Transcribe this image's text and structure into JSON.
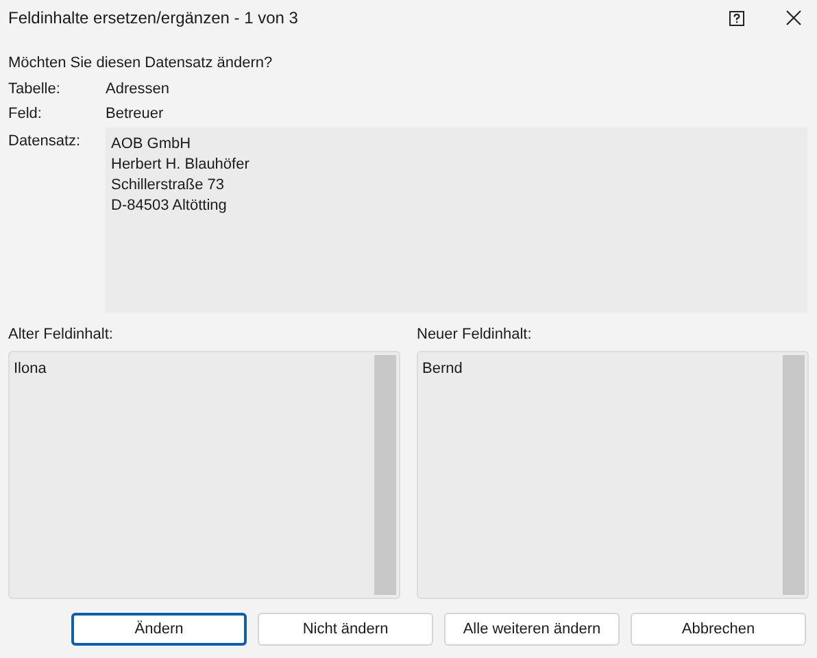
{
  "window": {
    "title": "Feldinhalte ersetzen/ergänzen - 1 von 3"
  },
  "question": "Möchten Sie diesen Datensatz ändern?",
  "info": [
    {
      "label": "Tabelle:",
      "value": "Adressen"
    },
    {
      "label": "Feld:",
      "value": "Betreuer"
    }
  ],
  "record": {
    "label": "Datensatz:",
    "lines": [
      "AOB GmbH",
      "Herbert H. Blauhöfer",
      "Schillerstraße 73",
      "D-84503 Altötting"
    ]
  },
  "old_content": {
    "label": "Alter Feldinhalt:",
    "value": "Ilona"
  },
  "new_content": {
    "label": "Neuer Feldinhalt:",
    "value": "Bernd"
  },
  "buttons": [
    {
      "label": "Ändern",
      "default": true
    },
    {
      "label": "Nicht ändern",
      "default": false
    },
    {
      "label": "Alle weiteren ändern",
      "default": false
    },
    {
      "label": "Abbrechen",
      "default": false
    }
  ]
}
